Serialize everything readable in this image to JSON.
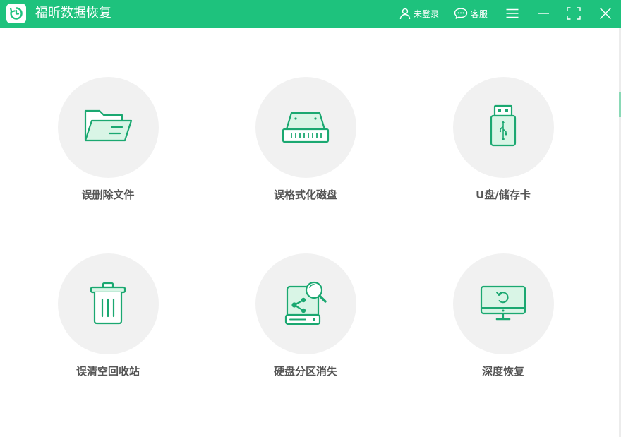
{
  "window": {
    "title": "福昕数据恢复",
    "login_label": "未登录",
    "service_label": "客服"
  },
  "colors": {
    "accent": "#1ec27d",
    "icon_stroke": "#1ba871",
    "icon_fill": "#d9f5e6",
    "circle": "#f1f1f1",
    "label": "#555555"
  },
  "options": [
    {
      "label": "误删除文件",
      "icon": "folder-icon"
    },
    {
      "label": "误格式化磁盘",
      "icon": "hard-disk-icon"
    },
    {
      "label": "U盘/储存卡",
      "icon": "usb-drive-icon"
    },
    {
      "label": "误清空回收站",
      "icon": "trash-bin-icon"
    },
    {
      "label": "硬盘分区消失",
      "icon": "partition-search-icon"
    },
    {
      "label": "深度恢复",
      "icon": "monitor-restore-icon"
    }
  ]
}
